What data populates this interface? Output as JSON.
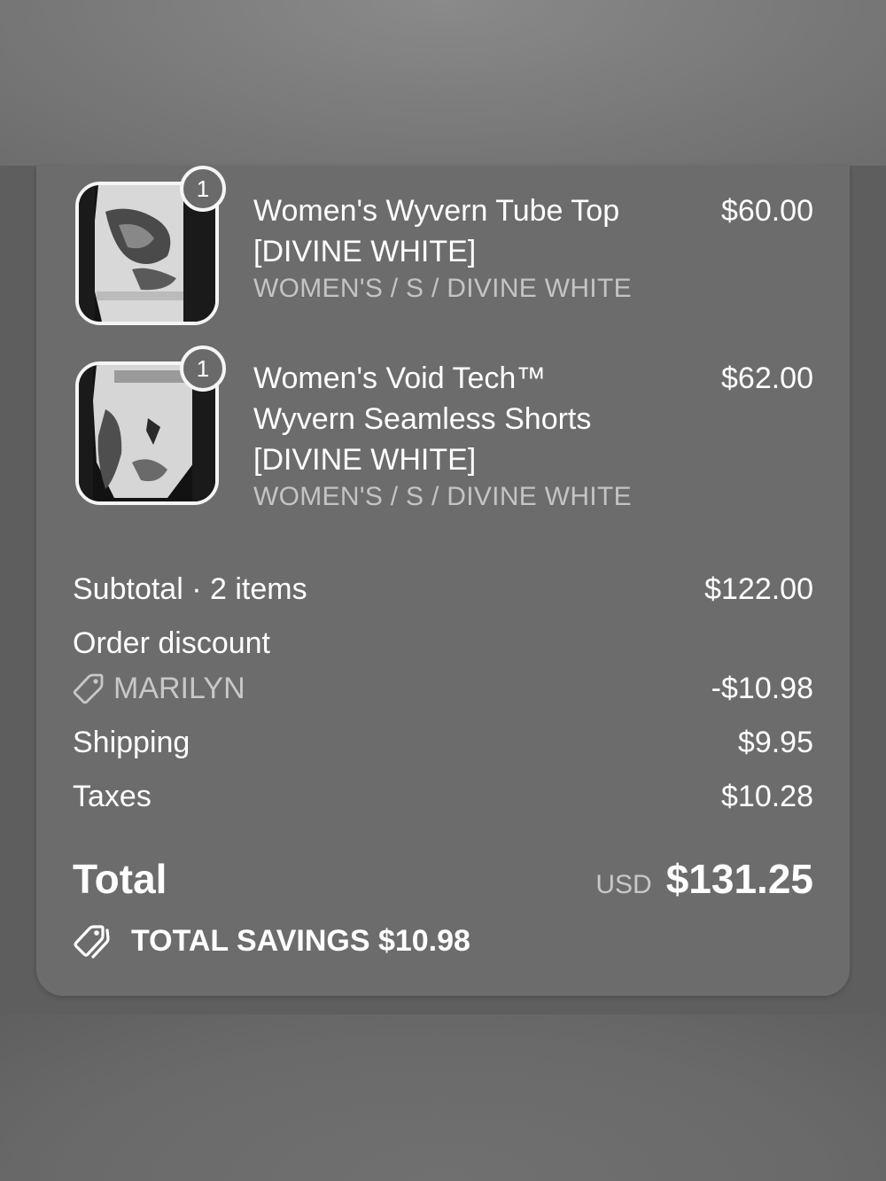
{
  "order_summary": {
    "items": [
      {
        "quantity": "1",
        "title_lines": [
          "Women's Wyvern Tube Top",
          "[DIVINE WHITE]"
        ],
        "variant": "WOMEN'S / S / DIVINE WHITE",
        "price": "$60.00",
        "image_icon": "product-photo-tube-top"
      },
      {
        "quantity": "1",
        "title_lines": [
          "Women's Void Tech™",
          "Wyvern Seamless Shorts",
          "[DIVINE WHITE]"
        ],
        "variant": "WOMEN'S / S / DIVINE WHITE",
        "price": "$62.00",
        "image_icon": "product-photo-shorts"
      }
    ],
    "subtotal": {
      "label": "Subtotal · 2 items",
      "value": "$122.00"
    },
    "order_discount": {
      "label": "Order discount",
      "code": "MARILYN",
      "code_icon": "tag-icon",
      "value": "-$10.98"
    },
    "shipping": {
      "label": "Shipping",
      "value": "$9.95"
    },
    "taxes": {
      "label": "Taxes",
      "value": "$10.28"
    },
    "total": {
      "label": "Total",
      "currency": "USD",
      "value": "$131.25"
    },
    "savings": {
      "icon": "tags-icon",
      "text": "TOTAL SAVINGS $10.98"
    }
  },
  "colors": {
    "card_background": "#6c6c6c",
    "overlay_background": "#5e5e5e",
    "primary_text": "#ffffff",
    "secondary_text": "#c4c4c4"
  }
}
